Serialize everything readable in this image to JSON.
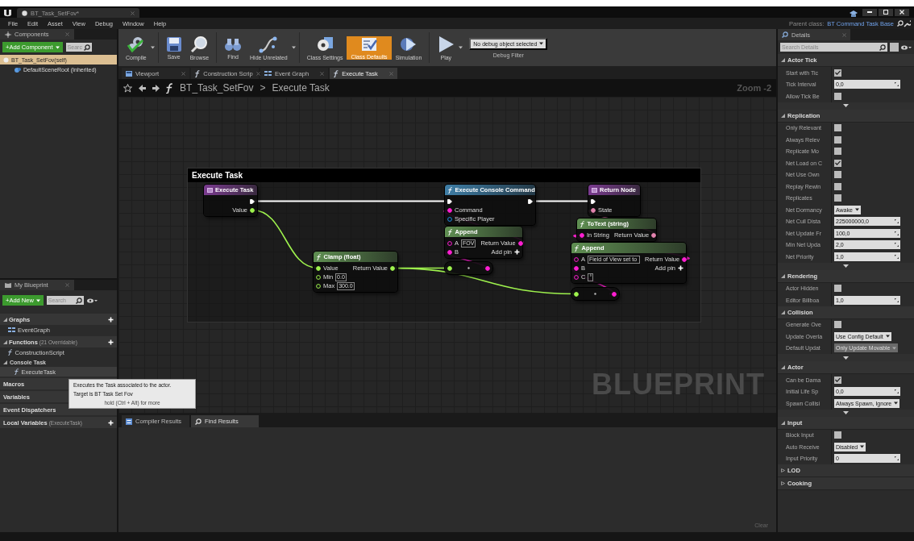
{
  "window": {
    "tab_title": "BT_Task_SetFov*",
    "parent_class_label": "Parent class:",
    "parent_class": "BT Command Task Base"
  },
  "menu": [
    "File",
    "Edit",
    "Asset",
    "View",
    "Debug",
    "Window",
    "Help"
  ],
  "components": {
    "tab": "Components",
    "add_button": "+Add Component",
    "search_placeholder": "Searc",
    "items": [
      {
        "label": "BT_Task_SetFov(self)",
        "kind": "self",
        "selected": true
      },
      {
        "label": "DefaultSceneRoot (Inherited)",
        "kind": "scene",
        "selected": false
      }
    ]
  },
  "toolbar": [
    {
      "label": "Compile",
      "kind": "compile",
      "dropdown": true,
      "selected": false
    },
    {
      "label": "Save",
      "kind": "save",
      "dropdown": false,
      "selected": false
    },
    {
      "label": "Browse",
      "kind": "browse",
      "dropdown": false,
      "selected": false
    },
    {
      "label": "Find",
      "kind": "find",
      "dropdown": false,
      "selected": false
    },
    {
      "label": "Hide Unrelated",
      "kind": "hide",
      "dropdown": true,
      "selected": false
    },
    {
      "label": "Class Settings",
      "kind": "settings",
      "dropdown": false,
      "selected": false
    },
    {
      "label": "Class Defaults",
      "kind": "defaults",
      "dropdown": false,
      "selected": true
    },
    {
      "label": "Simulation",
      "kind": "simulation",
      "dropdown": false,
      "selected": false
    },
    {
      "label": "Play",
      "kind": "play",
      "dropdown": true,
      "selected": false
    }
  ],
  "debug": {
    "value": "No debug object selected",
    "label": "Debug Filter"
  },
  "doc_tabs": [
    {
      "label": "Viewport",
      "kind": "viewport",
      "selected": false
    },
    {
      "label": "Construction Scrip",
      "kind": "function",
      "selected": false
    },
    {
      "label": "Event Graph",
      "kind": "graph",
      "selected": false
    },
    {
      "label": "Execute Task",
      "kind": "function",
      "selected": true
    }
  ],
  "breadcrumb": {
    "path": "BT_Task_SetFov",
    "separator": ">",
    "current": "Execute Task",
    "zoom": "Zoom -2"
  },
  "graph": {
    "comment": "Execute Task",
    "watermark": "BLUEPRINT",
    "nodes": [
      {
        "kind": "entry",
        "title": "Execute Task",
        "outputs": [
          {
            "kind": "exec",
            "connected": true
          },
          {
            "label": "Value",
            "kind": "float",
            "connected": true
          }
        ]
      },
      {
        "kind": "function",
        "title": "Execute Console Command",
        "inputs": [
          {
            "kind": "exec",
            "connected": true
          },
          {
            "label": "Command",
            "kind": "string",
            "connected": true
          },
          {
            "label": "Specific Player",
            "kind": "object",
            "connected": false
          }
        ],
        "outputs": [
          {
            "kind": "exec",
            "connected": true
          }
        ]
      },
      {
        "kind": "pure",
        "title": "Append",
        "inputs": [
          {
            "label": "A",
            "kind": "string",
            "connected": false,
            "value": "FOV"
          },
          {
            "label": "B",
            "kind": "string",
            "connected": true
          }
        ],
        "outputs": [
          {
            "label": "Return Value",
            "kind": "string",
            "connected": true
          }
        ],
        "add_pin": "Add pin"
      },
      {
        "kind": "conversion",
        "inputs": [
          {
            "kind": "float",
            "connected": true
          }
        ],
        "outputs": [
          {
            "kind": "string",
            "connected": true
          }
        ]
      },
      {
        "kind": "pure",
        "title": "Clamp (float)",
        "inputs": [
          {
            "label": "Value",
            "kind": "float",
            "connected": true
          },
          {
            "label": "Min",
            "kind": "float",
            "connected": false,
            "value": "0.0"
          },
          {
            "label": "Max",
            "kind": "float",
            "connected": false,
            "value": "300.0"
          }
        ],
        "outputs": [
          {
            "label": "Return Value",
            "kind": "float",
            "connected": true
          }
        ]
      },
      {
        "kind": "return",
        "title": "Return Node",
        "inputs": [
          {
            "kind": "exec",
            "connected": true
          },
          {
            "label": "State",
            "kind": "text",
            "connected": true
          }
        ]
      },
      {
        "kind": "pure",
        "title": "ToText (string)",
        "inputs": [
          {
            "label": "In String",
            "kind": "string",
            "connected": true
          }
        ],
        "outputs": [
          {
            "label": "Return Value",
            "kind": "text",
            "connected": true
          }
        ]
      },
      {
        "kind": "pure",
        "title": "Append",
        "inputs": [
          {
            "label": "A",
            "kind": "string",
            "connected": false,
            "value": "Field of View set to "
          },
          {
            "label": "B",
            "kind": "string",
            "connected": true
          },
          {
            "label": "C",
            "kind": "string",
            "connected": false,
            "value": "°"
          }
        ],
        "outputs": [
          {
            "label": "Return Value",
            "kind": "string",
            "connected": true
          }
        ],
        "add_pin": "Add pin"
      },
      {
        "kind": "conversion",
        "inputs": [
          {
            "kind": "float",
            "connected": true
          }
        ],
        "outputs": [
          {
            "kind": "string",
            "connected": true
          }
        ]
      }
    ]
  },
  "my_blueprint": {
    "tab": "My Blueprint",
    "add_button": "+Add New",
    "search_placeholder": "Search",
    "sections": [
      {
        "title": "Graphs",
        "expanded": true,
        "add": true,
        "items": [
          {
            "label": "EventGraph",
            "kind": "graph",
            "selected": false
          }
        ]
      },
      {
        "title": "Functions",
        "note": "(21 Overridable)",
        "expanded": true,
        "add": true,
        "items": [
          {
            "label": "ConstructionScript",
            "kind": "function",
            "selected": false
          },
          {
            "label": "Console Task",
            "kind": "category",
            "expanded": true,
            "children": [
              {
                "label": "ExecuteTask",
                "kind": "function",
                "selected": true
              }
            ]
          }
        ]
      },
      {
        "title": "Macros",
        "add": false
      },
      {
        "title": "Variables",
        "add": false
      },
      {
        "title": "Event Dispatchers",
        "add": false
      },
      {
        "title": "Local Variables",
        "note": "(ExecuteTask)",
        "add": true
      }
    ]
  },
  "tooltip": {
    "description": "Executes the Task associated to the actor.",
    "target": "Target is BT Task Set Fov",
    "hint": "hold (Ctrl + Alt) for more"
  },
  "results": {
    "tabs": [
      {
        "label": "Compiler Results",
        "selected": false
      },
      {
        "label": "Find Results",
        "selected": true
      }
    ],
    "clear": "Clear"
  },
  "details": {
    "tab": "Details",
    "search_placeholder": "Search Details",
    "sections": [
      {
        "title": "Actor Tick",
        "expanded": true,
        "advanced": true,
        "rows": [
          {
            "kind": "checkbox",
            "label": "Start with Tic",
            "checked": true
          },
          {
            "kind": "number",
            "label": "Tick Interval",
            "value": "0,0"
          },
          {
            "kind": "checkbox",
            "label": "Allow Tick Be",
            "checked": false
          }
        ]
      },
      {
        "title": "Replication",
        "expanded": true,
        "advanced": true,
        "rows": [
          {
            "kind": "checkbox",
            "label": "Only Relevant",
            "checked": false
          },
          {
            "kind": "checkbox",
            "label": "Always Relev",
            "checked": false
          },
          {
            "kind": "checkbox",
            "label": "Replicate Mo",
            "checked": false
          },
          {
            "kind": "checkbox",
            "label": "Net Load on C",
            "checked": true
          },
          {
            "kind": "checkbox",
            "label": "Net Use Own",
            "checked": false
          },
          {
            "kind": "checkbox",
            "label": "Replay Rewin",
            "checked": false
          },
          {
            "kind": "checkbox",
            "label": "Replicates",
            "checked": false
          },
          {
            "kind": "dropdown",
            "label": "Net Dormancy",
            "value": "Awake",
            "disabled": false
          },
          {
            "kind": "number",
            "label": "Net Cull Dista",
            "value": "225000000,0"
          },
          {
            "kind": "number",
            "label": "Net Update Fr",
            "value": "100,0"
          },
          {
            "kind": "number",
            "label": "Min Net Upda",
            "value": "2,0"
          },
          {
            "kind": "number",
            "label": "Net Priority",
            "value": "1,0"
          }
        ]
      },
      {
        "title": "Rendering",
        "expanded": true,
        "advanced": false,
        "rows": [
          {
            "kind": "checkbox",
            "label": "Actor Hidden",
            "checked": false
          },
          {
            "kind": "number",
            "label": "Editor Billboa",
            "value": "1,0"
          }
        ]
      },
      {
        "title": "Collision",
        "expanded": true,
        "advanced": true,
        "rows": [
          {
            "kind": "checkbox",
            "label": "Generate Ove",
            "checked": false
          },
          {
            "kind": "dropdown",
            "label": "Update Overla",
            "value": "Use Config Default",
            "disabled": false
          },
          {
            "kind": "dropdown",
            "label": "Default Updat",
            "value": "Only Update Movable",
            "disabled": true
          }
        ]
      },
      {
        "title": "Actor",
        "expanded": true,
        "advanced": true,
        "rows": [
          {
            "kind": "checkbox",
            "label": "Can be Dama",
            "checked": true
          },
          {
            "kind": "number",
            "label": "Initial Life Sp",
            "value": "0,0"
          },
          {
            "kind": "dropdown",
            "label": "Spawn Collisi",
            "value": "Always Spawn, Ignore",
            "disabled": false
          }
        ]
      },
      {
        "title": "Input",
        "expanded": true,
        "advanced": false,
        "rows": [
          {
            "kind": "checkbox",
            "label": "Block Input",
            "checked": false
          },
          {
            "kind": "dropdown",
            "label": "Auto Receive",
            "value": "Disabled",
            "disabled": false
          },
          {
            "kind": "number",
            "label": "Input Priority",
            "value": "0"
          }
        ]
      },
      {
        "title": "LOD",
        "expanded": false,
        "advanced": false
      },
      {
        "title": "Cooking",
        "expanded": false,
        "advanced": false
      }
    ]
  }
}
